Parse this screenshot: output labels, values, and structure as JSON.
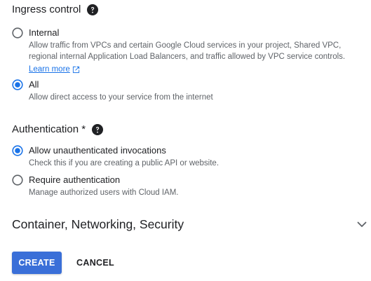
{
  "ingress": {
    "title": "Ingress control",
    "options": [
      {
        "label": "Internal",
        "description": "Allow traffic from VPCs and certain Google Cloud services in your project, Shared VPC, regional internal Application Load Balancers, and traffic allowed by VPC service controls.",
        "link": "Learn more",
        "selected": false
      },
      {
        "label": "All",
        "description": "Allow direct access to your service from the internet",
        "selected": true
      }
    ]
  },
  "authentication": {
    "title": "Authentication *",
    "options": [
      {
        "label": "Allow unauthenticated invocations",
        "description": "Check this if you are creating a public API or website.",
        "selected": true
      },
      {
        "label": "Require authentication",
        "description": "Manage authorized users with Cloud IAM.",
        "selected": false
      }
    ]
  },
  "advanced": {
    "title": "Container, Networking, Security",
    "expanded": false
  },
  "actions": {
    "create_label": "CREATE",
    "cancel_label": "CANCEL"
  },
  "colors": {
    "accent": "#1a73e8",
    "primary_button": "#3a6fd8",
    "text": "#202124",
    "secondary_text": "#5f6368"
  },
  "icons": {
    "help": "help-circle-icon",
    "external": "open-in-new-icon",
    "chevron": "chevron-down-icon"
  }
}
